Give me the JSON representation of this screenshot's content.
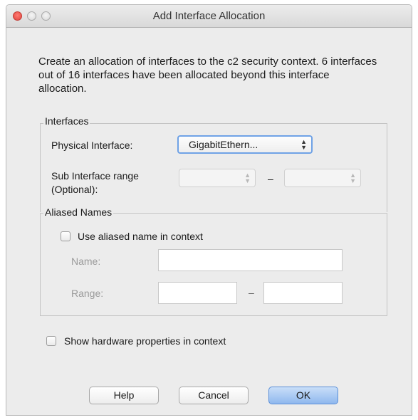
{
  "window": {
    "title": "Add Interface Allocation"
  },
  "description": "Create an allocation of interfaces to the c2 security context. 6 interfaces out of 16 interfaces have been allocated beyond this interface allocation.",
  "interfaces_group": {
    "legend": "Interfaces",
    "physical_label": "Physical Interface:",
    "physical_value": "GigabitEthern...",
    "sub_range_label_line1": "Sub Interface range",
    "sub_range_label_line2": "(Optional):",
    "sub_range_from": "",
    "sub_range_to": "",
    "separator": "–"
  },
  "aliased_group": {
    "legend": "Aliased Names",
    "use_alias_label": "Use aliased name in context",
    "use_alias_checked": false,
    "name_label": "Name:",
    "name_value": "",
    "range_label": "Range:",
    "range_from": "",
    "range_to": "",
    "separator": "–"
  },
  "show_hardware": {
    "label": "Show hardware properties in context",
    "checked": false
  },
  "buttons": {
    "help": "Help",
    "cancel": "Cancel",
    "ok": "OK"
  }
}
